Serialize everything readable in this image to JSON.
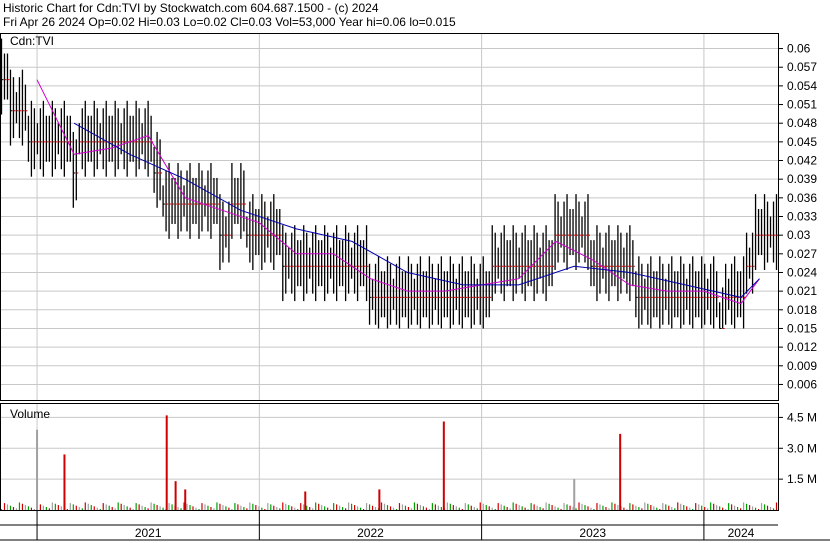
{
  "header": {
    "line1": "Historic Chart for Cdn:TVI by Stockwatch.com 604.687.1500 - (c) 2024",
    "line2": "Fri Apr 26 2024  Op=0.02  Hi=0.03  Lo=0.02  Cl=0.03  Vol=53,000  Year hi=0.06  lo=0.015"
  },
  "colors": {
    "up": "#d00000",
    "down": "#000000",
    "ma_short": "#cc00cc",
    "ma_long": "#0000aa",
    "grid": "#c8c8c8",
    "vol_up": "#00a000",
    "vol_down": "#d00000",
    "vol_flat": "#a0a0a0"
  },
  "chart_data": [
    {
      "type": "line",
      "title": "Cdn:TVI",
      "ylim": [
        0.0035,
        0.0625
      ],
      "y_ticks": [
        "0.06",
        "0.057",
        "0.054",
        "0.051",
        "0.048",
        "0.045",
        "0.042",
        "0.039",
        "0.036",
        "0.033",
        "0.03",
        "0.027",
        "0.024",
        "0.021",
        "0.018",
        "0.015",
        "0.012",
        "0.009",
        "0.006"
      ],
      "x_labels": [
        "2021",
        "2022",
        "2023",
        "2024"
      ],
      "x_range": [
        "2020-11",
        "2024-04"
      ],
      "series": [
        {
          "key": "close",
          "x": [
            "2020-11",
            "2020-12",
            "2021-01",
            "2021-02",
            "2021-03",
            "2021-04",
            "2021-05",
            "2021-06",
            "2021-07",
            "2021-08",
            "2021-09",
            "2021-10",
            "2021-11",
            "2021-12",
            "2022-01",
            "2022-02",
            "2022-03",
            "2022-04",
            "2022-05",
            "2022-06",
            "2022-07",
            "2022-08",
            "2022-09",
            "2022-10",
            "2022-11",
            "2022-12",
            "2023-01",
            "2023-02",
            "2023-03",
            "2023-04",
            "2023-05",
            "2023-06",
            "2023-07",
            "2023-08",
            "2023-09",
            "2023-10",
            "2023-11",
            "2023-12",
            "2024-01",
            "2024-02",
            "2024-03",
            "2024-04"
          ],
          "values": [
            0.055,
            0.05,
            0.045,
            0.045,
            0.042,
            0.044,
            0.045,
            0.047,
            0.045,
            0.035,
            0.033,
            0.035,
            0.032,
            0.033,
            0.03,
            0.028,
            0.025,
            0.025,
            0.027,
            0.026,
            0.022,
            0.021,
            0.021,
            0.02,
            0.021,
            0.022,
            0.021,
            0.024,
            0.023,
            0.025,
            0.028,
            0.029,
            0.027,
            0.024,
            0.023,
            0.021,
            0.021,
            0.022,
            0.02,
            0.017,
            0.02,
            0.03
          ]
        },
        {
          "key": "ma_short",
          "x": [
            "2021-01",
            "2021-03",
            "2021-05",
            "2021-07",
            "2021-09",
            "2021-11",
            "2022-01",
            "2022-03",
            "2022-05",
            "2022-07",
            "2022-09",
            "2022-11",
            "2023-01",
            "2023-03",
            "2023-05",
            "2023-07",
            "2023-09",
            "2023-11",
            "2024-01",
            "2024-03",
            "2024-04"
          ],
          "values": [
            0.055,
            0.043,
            0.044,
            0.046,
            0.036,
            0.034,
            0.032,
            0.027,
            0.027,
            0.023,
            0.021,
            0.021,
            0.022,
            0.023,
            0.029,
            0.026,
            0.022,
            0.021,
            0.021,
            0.019,
            0.023
          ]
        },
        {
          "key": "ma_long",
          "x": [
            "2021-03",
            "2021-06",
            "2021-09",
            "2021-12",
            "2022-03",
            "2022-06",
            "2022-09",
            "2022-12",
            "2023-03",
            "2023-06",
            "2023-09",
            "2023-12",
            "2024-03",
            "2024-04"
          ],
          "values": [
            0.048,
            0.043,
            0.039,
            0.034,
            0.031,
            0.029,
            0.024,
            0.022,
            0.022,
            0.025,
            0.024,
            0.022,
            0.02,
            0.023
          ]
        }
      ]
    },
    {
      "type": "bar",
      "title": "Volume",
      "ylim": [
        0,
        5.2
      ],
      "y_ticks": [
        "4.5 M",
        "3.0 M",
        "1.5 M"
      ],
      "x": [
        "2021-01",
        "2021-02",
        "2021-08",
        "2021-08",
        "2021-09",
        "2022-07",
        "2022-10",
        "2023-08",
        "2023-06",
        "2022-03"
      ],
      "values": [
        3.9,
        2.7,
        4.6,
        1.4,
        1.0,
        1.0,
        4.3,
        3.7,
        1.5,
        0.9
      ],
      "value_unit": "M"
    }
  ]
}
